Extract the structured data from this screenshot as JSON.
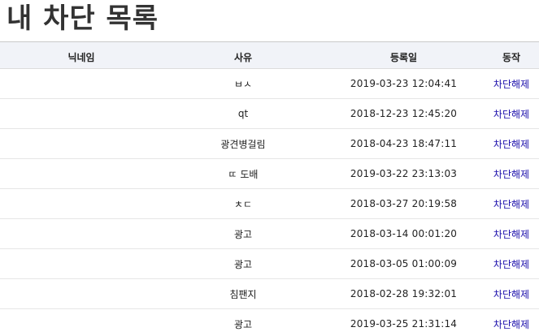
{
  "page": {
    "title": "내 차단 목록"
  },
  "table": {
    "headers": {
      "nickname": "닉네임",
      "reason": "사유",
      "date": "등록일",
      "action": "동작"
    },
    "rows": [
      {
        "nickname": "",
        "reason": "ㅂㅅ",
        "date": "2019-03-23 12:04:41",
        "action": "차단해제"
      },
      {
        "nickname": "",
        "reason": "qt",
        "date": "2018-12-23 12:45:20",
        "action": "차단해제"
      },
      {
        "nickname": "",
        "reason": "광견병걸림",
        "date": "2018-04-23 18:47:11",
        "action": "차단해제"
      },
      {
        "nickname": "",
        "reason": "ㄸ 도배",
        "date": "2019-03-22 23:13:03",
        "action": "차단해제"
      },
      {
        "nickname": "",
        "reason": "ㅊㄷ",
        "date": "2018-03-27 20:19:58",
        "action": "차단해제"
      },
      {
        "nickname": "",
        "reason": "광고",
        "date": "2018-03-14 00:01:20",
        "action": "차단해제"
      },
      {
        "nickname": "",
        "reason": "광고",
        "date": "2018-03-05 01:00:09",
        "action": "차단해제"
      },
      {
        "nickname": "",
        "reason": "침팬지",
        "date": "2018-02-28 19:32:01",
        "action": "차단해제"
      },
      {
        "nickname": "",
        "reason": "광고",
        "date": "2019-03-25 21:31:14",
        "action": "차단해제"
      }
    ]
  },
  "colors": {
    "header_bg": "#f1f3f8",
    "link": "#1a0dab",
    "title": "#333333"
  }
}
